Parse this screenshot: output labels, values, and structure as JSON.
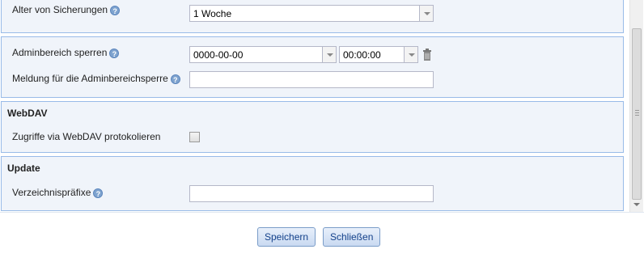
{
  "backup": {
    "age_label": "Alter von Sicherungen",
    "age_value": "1 Woche"
  },
  "admin": {
    "lock_label": "Adminbereich sperren",
    "lock_date": "0000-00-00",
    "lock_time": "00:00:00",
    "message_label": "Meldung für die Adminbereichsperre",
    "message_value": ""
  },
  "webdav": {
    "legend": "WebDAV",
    "log_label": "Zugriffe via WebDAV protokolieren",
    "log_checked": false
  },
  "update": {
    "legend": "Update",
    "prefix_label": "Verzeichnispräfixe",
    "prefix_value": ""
  },
  "buttons": {
    "save": "Speichern",
    "close": "Schließen"
  },
  "icons": {
    "help": "question-icon",
    "delete": "trash-icon"
  }
}
